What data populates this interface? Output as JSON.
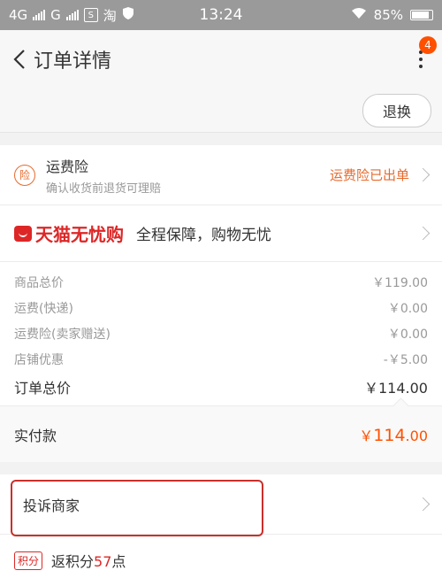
{
  "status_bar": {
    "network_left": "4G",
    "network_second": "G",
    "badge_s": "S",
    "badge_taobao": "淘",
    "time": "13:24",
    "battery": "85%"
  },
  "nav": {
    "back_icon": "chevron-left-icon",
    "title": "订单详情",
    "more_icon": "more-vertical-icon",
    "notification_count": "4"
  },
  "actions": {
    "return_exchange": "退换"
  },
  "insurance": {
    "icon_char": "险",
    "title": "运费险",
    "subtitle": "确认收货前退货可理赔",
    "status": "运费险已出单"
  },
  "tmall": {
    "logo_text": "天猫无忧购",
    "slogan": "全程保障，购物无忧"
  },
  "summary": {
    "rows": [
      {
        "label": "商品总价",
        "value": "￥119.00"
      },
      {
        "label": "运费(快递)",
        "value": "￥0.00"
      },
      {
        "label": "运费险(卖家赠送)",
        "value": "￥0.00"
      },
      {
        "label": "店铺优惠",
        "value": "-￥5.00"
      }
    ],
    "total_label": "订单总价",
    "total_value": "￥114.00"
  },
  "paid": {
    "label": "实付款",
    "currency": "￥",
    "amount_main": "114",
    "amount_decimal": ".00"
  },
  "complain": {
    "label": "投诉商家"
  },
  "points": {
    "badge": "积分",
    "prefix": "返积分",
    "value": "57",
    "suffix": "点"
  },
  "colors": {
    "accent": "#ff5000",
    "insurance_orange": "#e76a2c",
    "tmall_red": "#dd2727",
    "highlight_box": "#c9302c"
  }
}
